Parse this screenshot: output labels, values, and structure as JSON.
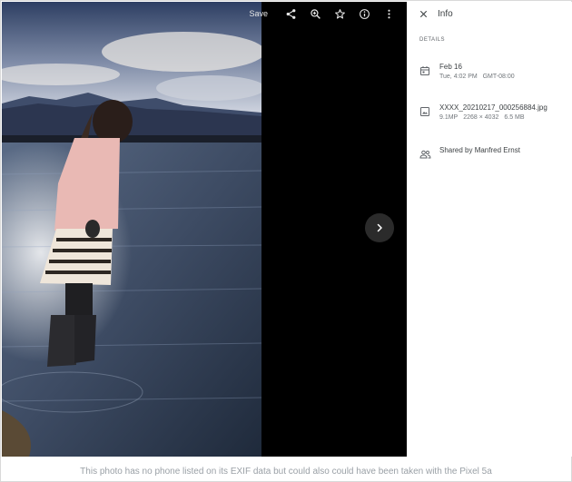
{
  "toolbar": {
    "save_label": "Save",
    "icons": [
      "share-icon",
      "zoom-in-icon",
      "star-icon",
      "info-icon",
      "more-vert-icon"
    ]
  },
  "navigation": {
    "next_icon": "chevron-right-icon"
  },
  "panel": {
    "close_icon": "close-icon",
    "title": "Info",
    "section_label": "DETAILS",
    "date": {
      "primary": "Feb 16",
      "secondary": "Tue, 4:02 PM   GMT-08:00"
    },
    "file": {
      "name": "XXXX_20210217_000256884.jpg",
      "megapixels": "9.1MP",
      "dimensions": "2268 × 4032",
      "size": "6.5 MB"
    },
    "shared": {
      "text": "Shared by Manfred Ernst"
    }
  },
  "caption": "This photo has no phone listed on its EXIF data but could also could have been taken with the Pixel 5a",
  "colors": {
    "viewer_bg": "#000000",
    "panel_bg": "#ffffff",
    "caption": "#9aa0a6"
  }
}
